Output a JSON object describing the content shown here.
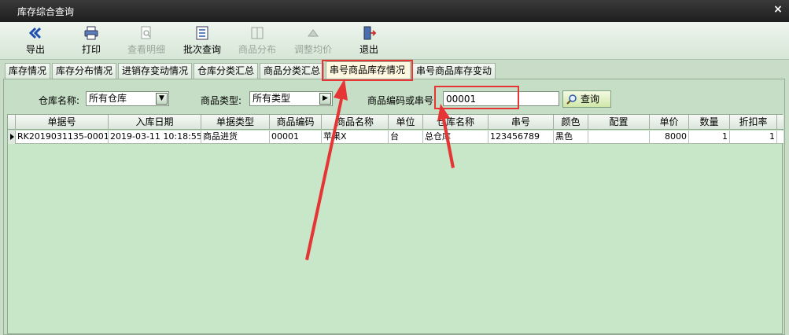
{
  "window": {
    "title": "库存综合查询",
    "close_glyph": "×"
  },
  "toolbar": {
    "buttons": [
      {
        "label": "导出",
        "icon": "double-chevron-left-icon",
        "enabled": true
      },
      {
        "label": "打印",
        "icon": "printer-icon",
        "enabled": true
      },
      {
        "label": "查看明细",
        "icon": "document-search-icon",
        "enabled": false
      },
      {
        "label": "批次查询",
        "icon": "list-icon",
        "enabled": true
      },
      {
        "label": "商品分布",
        "icon": "columns-icon",
        "enabled": false
      },
      {
        "label": "调整均价",
        "icon": "triangle-up-icon",
        "enabled": false
      },
      {
        "label": "退出",
        "icon": "exit-door-icon",
        "enabled": true
      }
    ]
  },
  "tabs": [
    {
      "label": "库存情况"
    },
    {
      "label": "库存分布情况"
    },
    {
      "label": "进销存变动情况"
    },
    {
      "label": "仓库分类汇总"
    },
    {
      "label": "商品分类汇总"
    },
    {
      "label": "串号商品库存情况",
      "active": true
    },
    {
      "label": "串号商品库存变动"
    }
  ],
  "filters": {
    "warehouse_label": "仓库名称:",
    "warehouse_value": "所有仓库",
    "category_label": "商品类型:",
    "category_value": "所有类型",
    "code_label": "商品编码或串号:",
    "code_value": "00001",
    "query_label": "查询"
  },
  "table": {
    "columns": [
      "单据号",
      "入库日期",
      "单据类型",
      "商品编码",
      "商品名称",
      "单位",
      "仓库名称",
      "串号",
      "颜色",
      "配置",
      "单价",
      "数量",
      "折扣率"
    ],
    "rows": [
      [
        "RK2019031135-0001",
        "2019-03-11 10:18:55",
        "商品进货",
        "00001",
        "苹果X",
        "台",
        "总仓库",
        "123456789",
        "黑色",
        "",
        "8000",
        "1",
        "1"
      ]
    ]
  },
  "colors": {
    "highlight": "#e53535",
    "background": "#c8dcc8"
  }
}
